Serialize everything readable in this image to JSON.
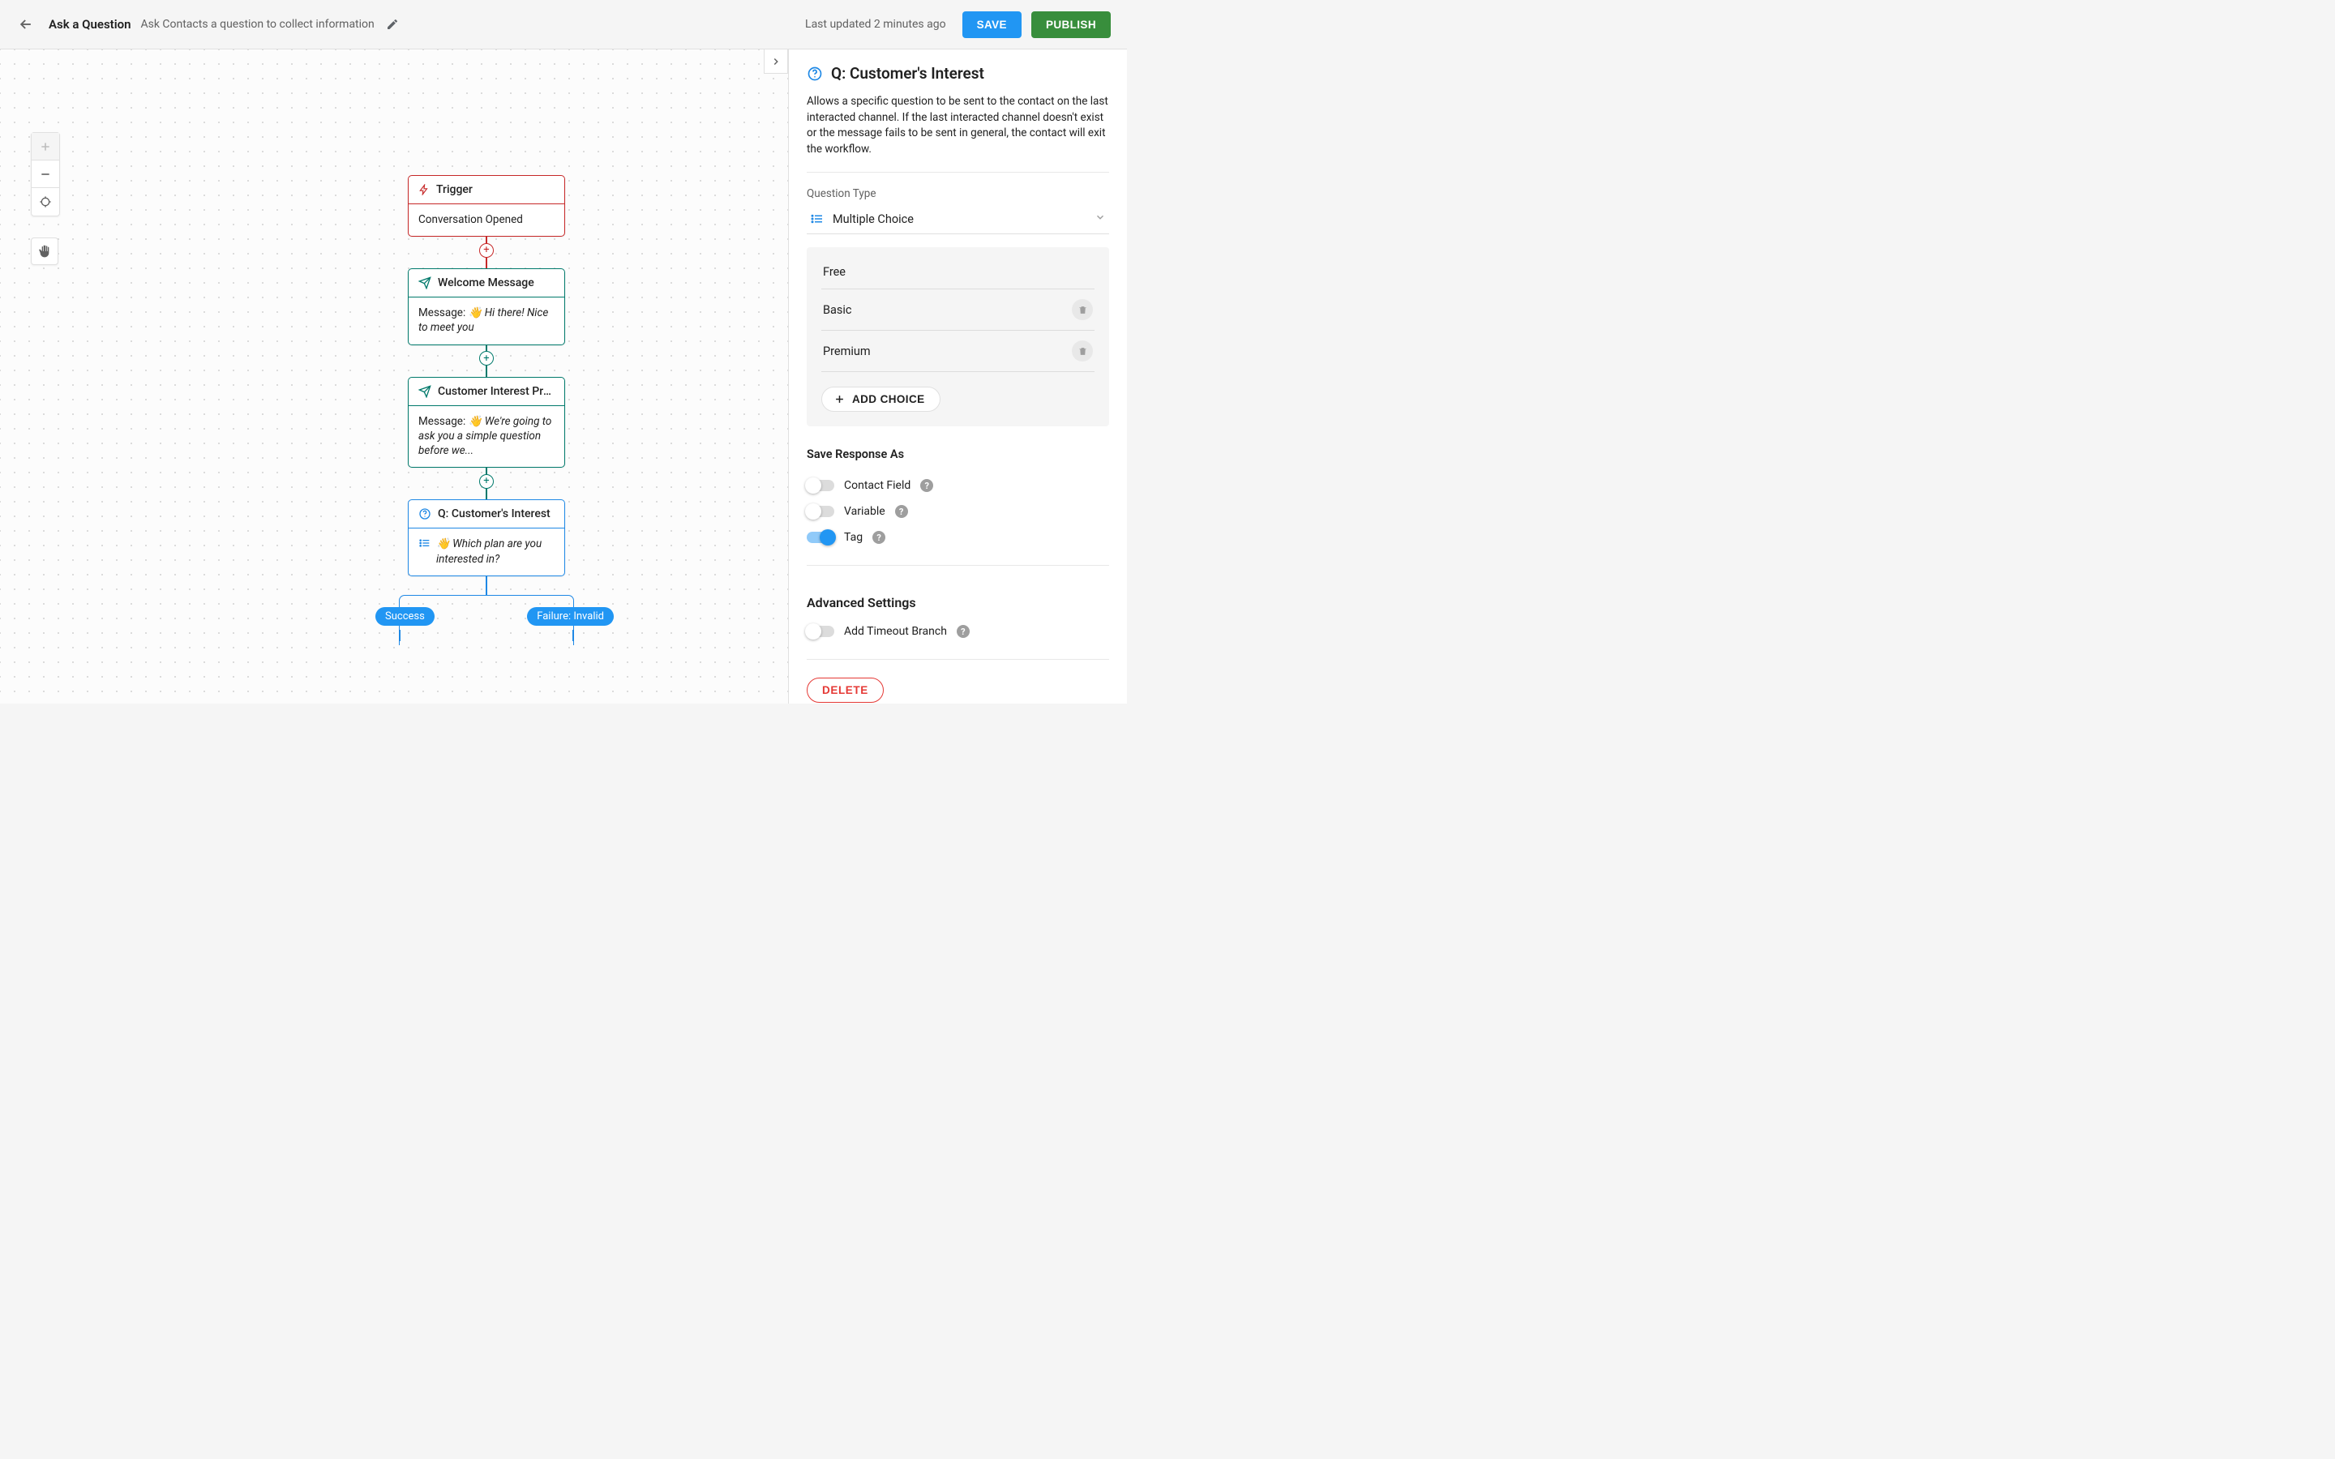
{
  "header": {
    "title": "Ask a Question",
    "subtitle": "Ask Contacts a question to collect information",
    "last_updated": "Last updated 2 minutes ago",
    "save_label": "SAVE",
    "publish_label": "PUBLISH"
  },
  "nodes": {
    "trigger": {
      "title": "Trigger",
      "body": "Conversation Opened"
    },
    "welcome": {
      "title": "Welcome Message",
      "label": "Message:",
      "text": "👋 Hi there! Nice to meet you"
    },
    "premium": {
      "title": "Customer Interest Premi…",
      "label": "Message:",
      "text": "👋 We're going to ask you a simple question before we..."
    },
    "question": {
      "title": "Q: Customer's Interest",
      "text": "👋 Which plan are you interested in?"
    },
    "branches": {
      "success": "Success",
      "failure": "Failure: Invalid"
    }
  },
  "panel": {
    "title": "Q: Customer's Interest",
    "description": "Allows a specific question to be sent to the contact on the last interacted channel. If the last interacted channel doesn't exist or the message fails to be sent in general, the contact will exit the workflow.",
    "question_type_label": "Question Type",
    "question_type_value": "Multiple Choice",
    "choices": [
      "Free",
      "Basic",
      "Premium"
    ],
    "add_choice_label": "ADD CHOICE",
    "save_as_label": "Save Response As",
    "toggles": {
      "contact_field": {
        "label": "Contact Field",
        "on": false
      },
      "variable": {
        "label": "Variable",
        "on": false
      },
      "tag": {
        "label": "Tag",
        "on": true
      }
    },
    "advanced_label": "Advanced Settings",
    "timeout": {
      "label": "Add Timeout Branch",
      "on": false
    },
    "delete_label": "DELETE"
  },
  "colors": {
    "trigger": "#c62828",
    "message": "#00796B",
    "question": "#1E88E5",
    "save": "#2196F3",
    "publish": "#388E3C"
  }
}
